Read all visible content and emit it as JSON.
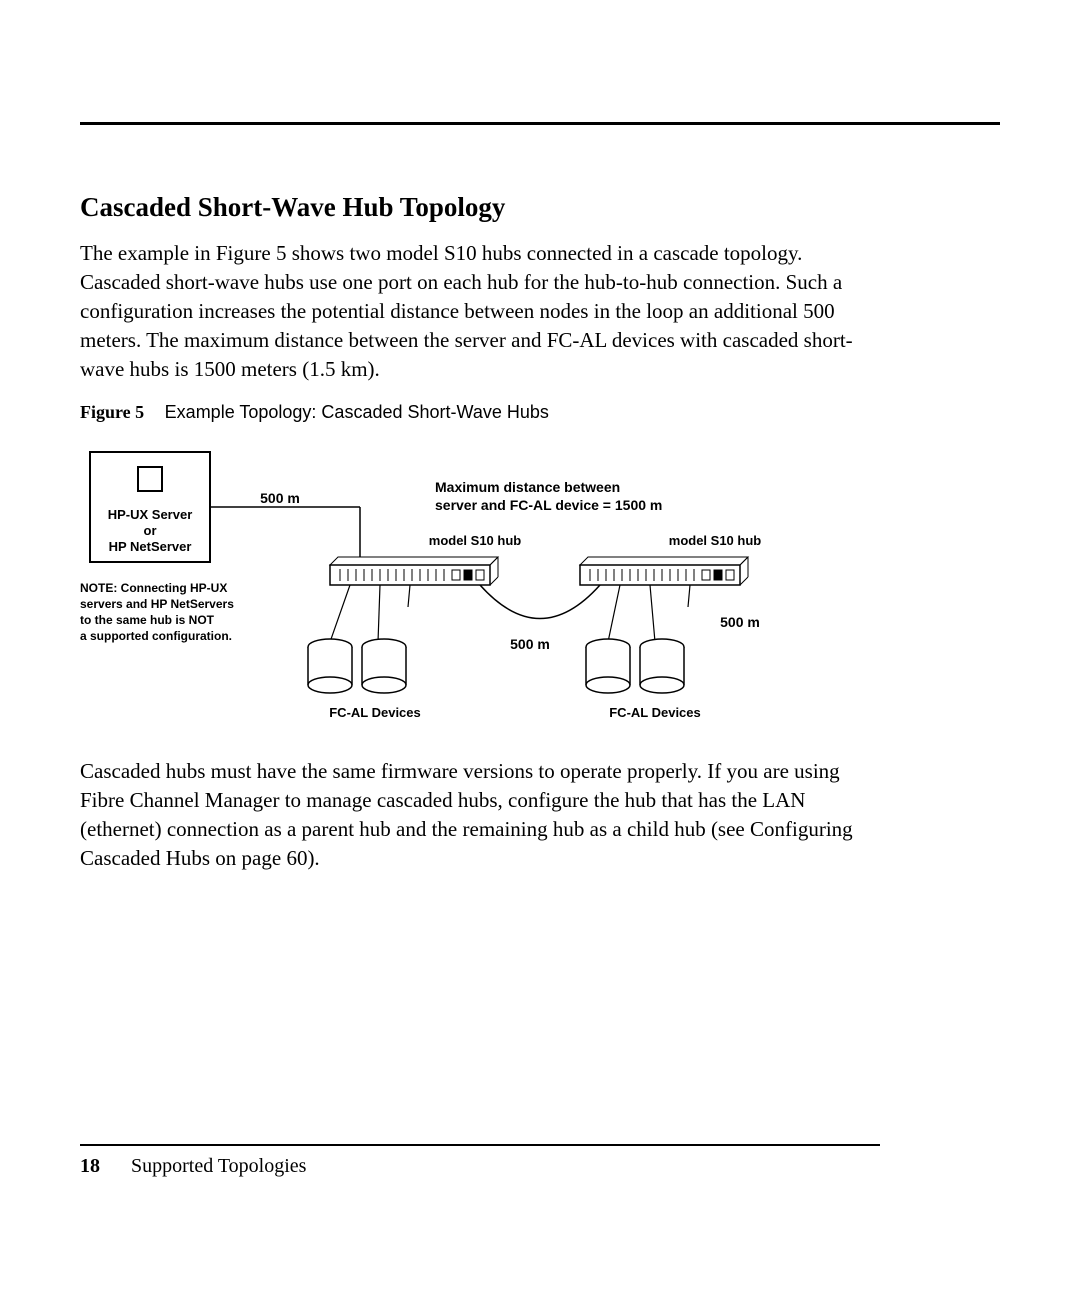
{
  "section": {
    "title": "Cascaded Short-Wave Hub Topology",
    "paragraph1": "The example in Figure 5 shows two model S10 hubs connected in a cascade topology. Cascaded short-wave hubs use one port on each hub for the hub-to-hub connection. Such a configuration increases the potential distance between nodes in the loop an additional 500 meters. The maximum distance between the server and FC-AL devices with cascaded short-wave hubs is 1500 meters (1.5 km).",
    "paragraph2": "Cascaded hubs must have the same firmware versions to operate properly. If you are using Fibre Channel Manager to manage cascaded hubs, configure the hub that has the LAN (ethernet) connection as a parent hub and the remaining hub as a child hub (see Configuring Cascaded Hubs on page 60)."
  },
  "figure": {
    "label": "Figure 5",
    "caption": "Example Topology: Cascaded Short-Wave Hubs",
    "server_line1": "HP-UX Server",
    "server_line2": "or",
    "server_line3": "HP NetServer",
    "note_line1": "NOTE: Connecting HP-UX",
    "note_line2": "servers and HP NetServers",
    "note_line3": "to the same hub is NOT",
    "note_line4": "a supported configuration.",
    "dist500_a": "500 m",
    "dist500_b": "500 m",
    "dist500_c": "500 m",
    "max_line1": "Maximum distance between",
    "max_line2": "server and FC-AL device = 1500 m",
    "hub1_label": "model S10 hub",
    "hub2_label": "model S10 hub",
    "dev1_label": "FC-AL Devices",
    "dev2_label": "FC-AL Devices"
  },
  "footer": {
    "page_number": "18",
    "section_name": "Supported Topologies"
  }
}
